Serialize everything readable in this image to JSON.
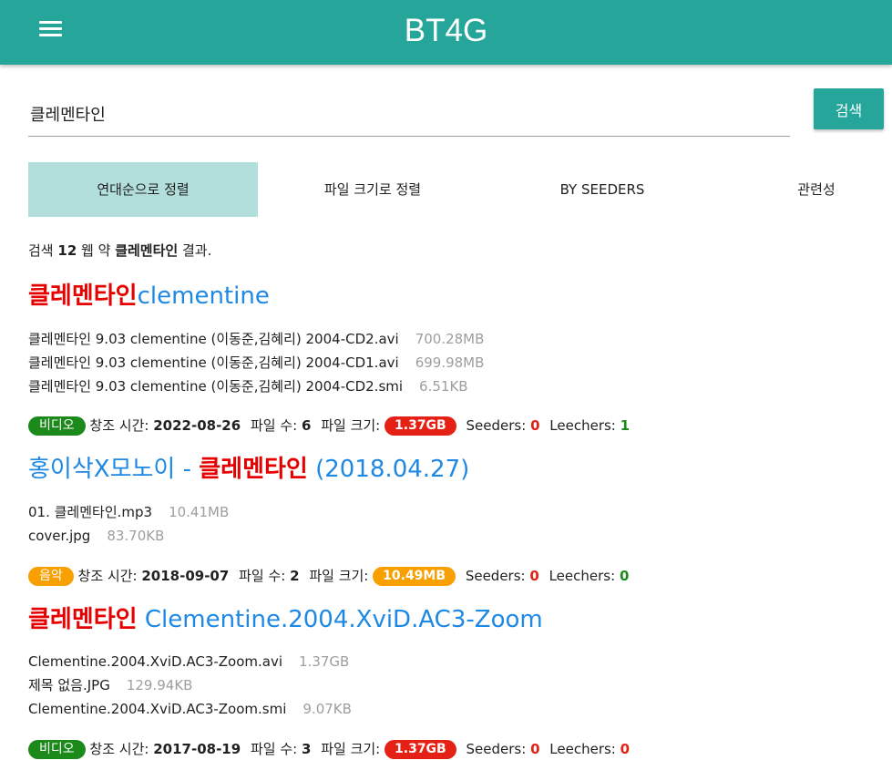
{
  "navbar": {
    "brand": "BT4G",
    "menu_icon": "hamburger-menu-icon"
  },
  "search": {
    "value": "클레멘타인",
    "button_label": "검색"
  },
  "tabs": [
    {
      "label": "연대순으로 정렬",
      "active": true
    },
    {
      "label": "파일 크기로 정렬",
      "active": false
    },
    {
      "label": "BY SEEDERS",
      "active": false
    },
    {
      "label": "관련성",
      "active": false
    }
  ],
  "summary": {
    "prefix": "검색",
    "count": "12",
    "mid": "웹 약",
    "query": "클레멘타인",
    "suffix": "결과."
  },
  "labels": {
    "created": "창조 시간:",
    "file_count": "파일 수:",
    "file_size": "파일 크기:",
    "seeders": "Seeders:",
    "leechers": "Leechers:"
  },
  "results": [
    {
      "title_highlight": "클레멘타인",
      "title_rest": "clementine",
      "title_prefix": "",
      "title_suffix": "",
      "files": [
        {
          "name": "클레멘타인 9.03 clementine (이동준,김혜리) 2004-CD2.avi",
          "size": "700.28MB"
        },
        {
          "name": "클레멘타인 9.03 clementine (이동준,김혜리) 2004-CD1.avi",
          "size": "699.98MB"
        },
        {
          "name": "클레멘타인 9.03 clementine (이동준,김혜리) 2004-CD2.smi",
          "size": "6.51KB"
        }
      ],
      "category": "비디오",
      "category_color": "#1b8a1b",
      "created": "2022-08-26",
      "file_count": "6",
      "total_size": "1.37GB",
      "size_color": "#e52014",
      "seeders": "0",
      "leechers": "1"
    },
    {
      "title_prefix": "홍이삭X모노이 - ",
      "title_highlight": "클레멘타인",
      "title_suffix": " (2018.04.27)",
      "title_rest": "",
      "files": [
        {
          "name": "01. 클레멘타인.mp3",
          "size": "10.41MB"
        },
        {
          "name": "cover.jpg",
          "size": "83.70KB"
        }
      ],
      "category": "음악",
      "category_color": "#f7a000",
      "created": "2018-09-07",
      "file_count": "2",
      "total_size": "10.49MB",
      "size_color": "#f7a000",
      "seeders": "0",
      "leechers": "0"
    },
    {
      "title_prefix": "",
      "title_highlight": "클레멘타인",
      "title_rest": " Clementine.2004.XviD.AC3-Zoom",
      "title_suffix": "",
      "files": [
        {
          "name": "Clementine.2004.XviD.AC3-Zoom.avi",
          "size": "1.37GB"
        },
        {
          "name": "제목 없음.JPG",
          "size": "129.94KB"
        },
        {
          "name": "Clementine.2004.XviD.AC3-Zoom.smi",
          "size": "9.07KB"
        }
      ],
      "category": "비디오",
      "category_color": "#1b8a1b",
      "created": "2017-08-19",
      "file_count": "3",
      "total_size": "1.37GB",
      "size_color": "#e52014",
      "seeders": "0",
      "leechers": "0"
    }
  ]
}
